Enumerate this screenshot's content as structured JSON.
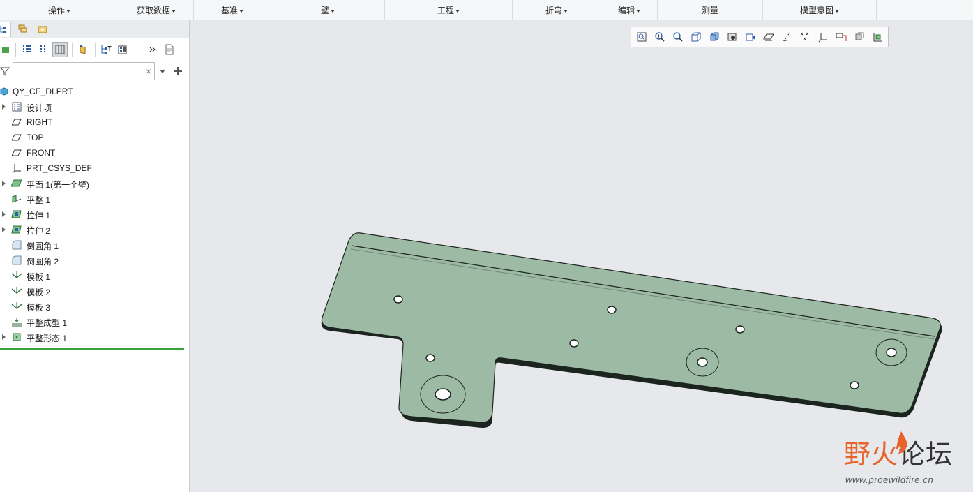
{
  "ribbon": {
    "groups": [
      {
        "label": "操作",
        "has_menu": true
      },
      {
        "label": "获取数据",
        "has_menu": true
      },
      {
        "label": "基准",
        "has_menu": true
      },
      {
        "label": "壁",
        "has_menu": true
      },
      {
        "label": "工程",
        "has_menu": true
      },
      {
        "label": "折弯",
        "has_menu": true
      },
      {
        "label": "编辑",
        "has_menu": true
      },
      {
        "label": "测量",
        "has_menu": false
      },
      {
        "label": "模型意图",
        "has_menu": true
      }
    ]
  },
  "model_tree": {
    "search": {
      "value": "",
      "clear": "×"
    },
    "root": {
      "label": "QY_CE_DI.PRT",
      "icon": "part-icon"
    },
    "items": [
      {
        "label": "设计项",
        "icon": "design-items-icon",
        "expandable": true
      },
      {
        "label": "RIGHT",
        "icon": "datum-plane-icon",
        "expandable": false
      },
      {
        "label": "TOP",
        "icon": "datum-plane-icon",
        "expandable": false
      },
      {
        "label": "FRONT",
        "icon": "datum-plane-icon",
        "expandable": false
      },
      {
        "label": "PRT_CSYS_DEF",
        "icon": "csys-icon",
        "expandable": false
      },
      {
        "label": "平面 1(第一个壁)",
        "icon": "planar-wall-icon",
        "expandable": true
      },
      {
        "label": "平整 1",
        "icon": "flat-wall-icon",
        "expandable": false
      },
      {
        "label": "拉伸 1",
        "icon": "extrude-icon",
        "expandable": true
      },
      {
        "label": "拉伸 2",
        "icon": "extrude-icon",
        "expandable": true
      },
      {
        "label": "倒圆角 1",
        "icon": "round-icon",
        "expandable": false
      },
      {
        "label": "倒圆角 2",
        "icon": "round-icon",
        "expandable": false
      },
      {
        "label": "模板 1",
        "icon": "form-icon",
        "expandable": false
      },
      {
        "label": "模板 2",
        "icon": "form-icon",
        "expandable": false
      },
      {
        "label": "模板 3",
        "icon": "form-icon",
        "expandable": false
      },
      {
        "label": "平整成型 1",
        "icon": "flatten-form-icon",
        "expandable": false
      },
      {
        "label": "平整形态 1",
        "icon": "flat-pattern-icon",
        "expandable": true
      }
    ]
  },
  "viewport_toolbar": [
    "refit-icon",
    "zoom-in-icon",
    "zoom-out-icon",
    "repaint-icon",
    "display-style-icon",
    "saved-views-icon",
    "view-manager-icon",
    "plane-display-icon",
    "axis-display-icon",
    "point-display-icon",
    "csys-display-icon",
    "annotation-display-icon",
    "spin-center-icon",
    "perspective-icon"
  ],
  "model": {
    "face_color": "#9dbaa4",
    "edge_color": "#1c241f"
  },
  "watermark": {
    "part1": "野火",
    "part2": "论坛",
    "url": "www.proewildfire.cn"
  }
}
